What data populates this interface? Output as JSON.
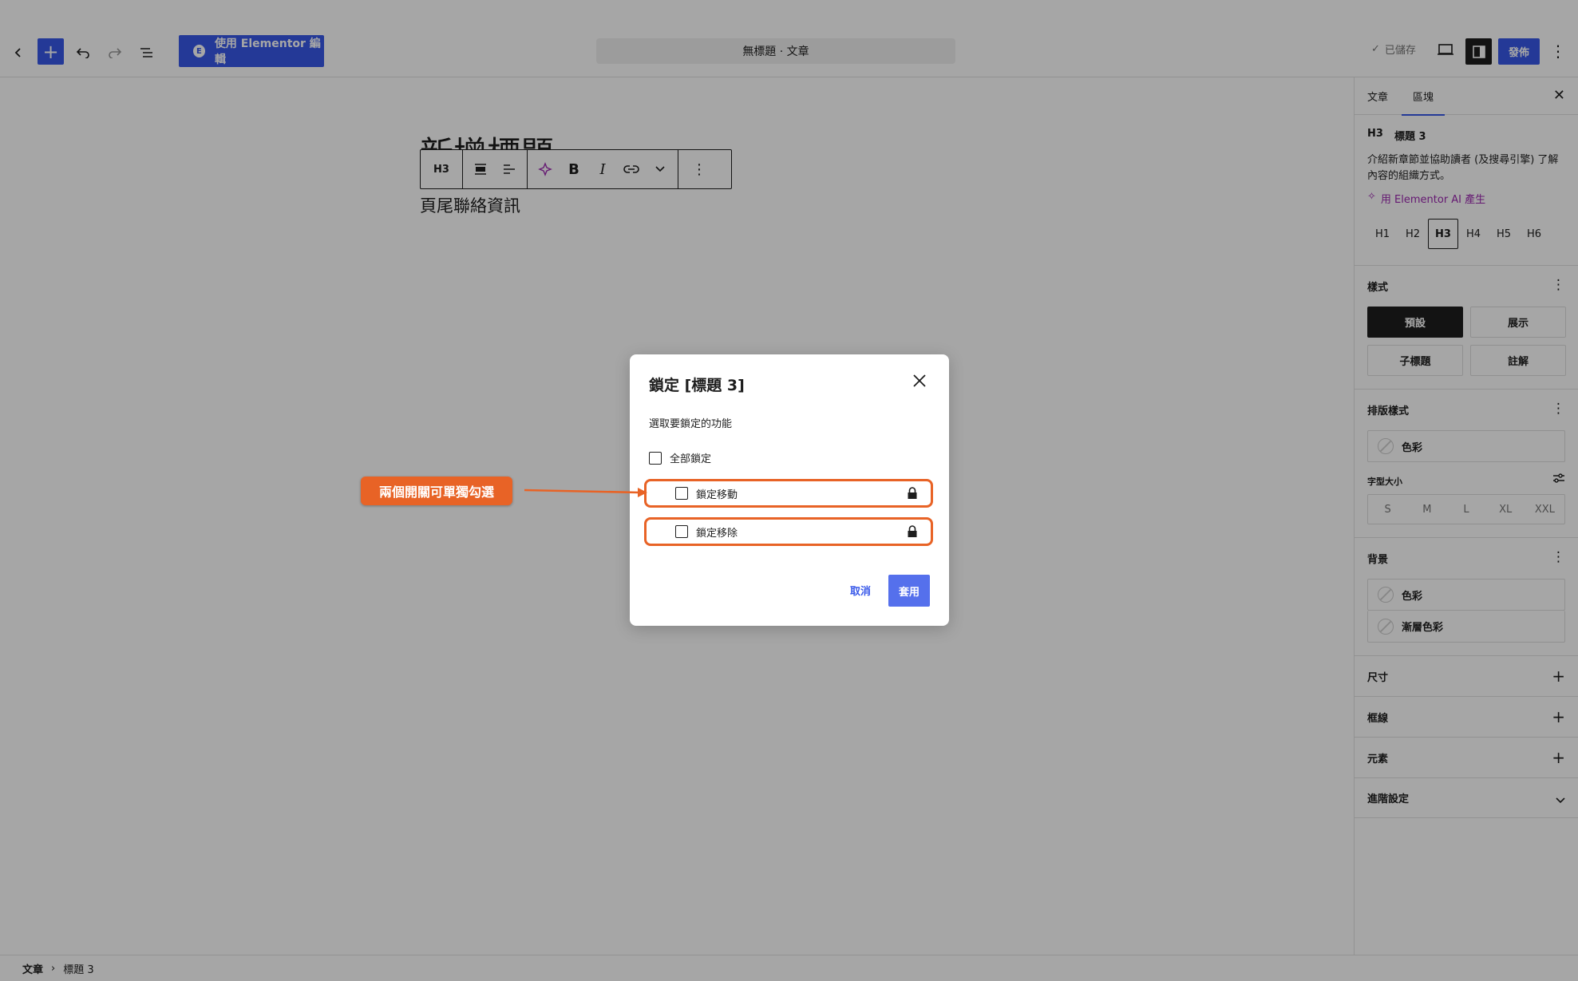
{
  "topbar": {
    "elementor_button": "使用 Elementor 編輯",
    "doc_title": "無標題 · 文章",
    "saved": "已儲存",
    "publish": "發佈"
  },
  "canvas": {
    "post_title": "新增標題",
    "heading_text": "頁尾聯絡資訊",
    "toolbar_level": "H3"
  },
  "sidebar": {
    "tabs": [
      "文章",
      "區塊"
    ],
    "block_tag": "H3",
    "block_name": "標題 3",
    "block_desc": "介紹新章節並協助讀者 (及搜尋引擎) 了解內容的組織方式。",
    "ai_link": "用 Elementor AI 產生",
    "levels": [
      "H1",
      "H2",
      "H3",
      "H4",
      "H5",
      "H6"
    ],
    "styles_title": "樣式",
    "styles": [
      "預設",
      "展示",
      "子標題",
      "註解"
    ],
    "typography_title": "排版樣式",
    "color_label": "色彩",
    "font_size_label": "字型大小",
    "font_sizes": [
      "S",
      "M",
      "L",
      "XL",
      "XXL"
    ],
    "background_title": "背景",
    "bg_color": "色彩",
    "bg_gradient": "漸層色彩",
    "dimensions": "尺寸",
    "border": "框線",
    "elements": "元素",
    "advanced": "進階設定"
  },
  "footer": {
    "crumb_root": "文章",
    "crumb_current": "標題 3"
  },
  "modal": {
    "title": "鎖定 [標題 3]",
    "subtitle": "選取要鎖定的功能",
    "lock_all": "全部鎖定",
    "lock_move": "鎖定移動",
    "lock_remove": "鎖定移除",
    "cancel": "取消",
    "apply": "套用"
  },
  "annotation": {
    "callout": "兩個開關可單獨勾選"
  },
  "colors": {
    "accent": "#3858e9",
    "annotation": "#e86326"
  }
}
